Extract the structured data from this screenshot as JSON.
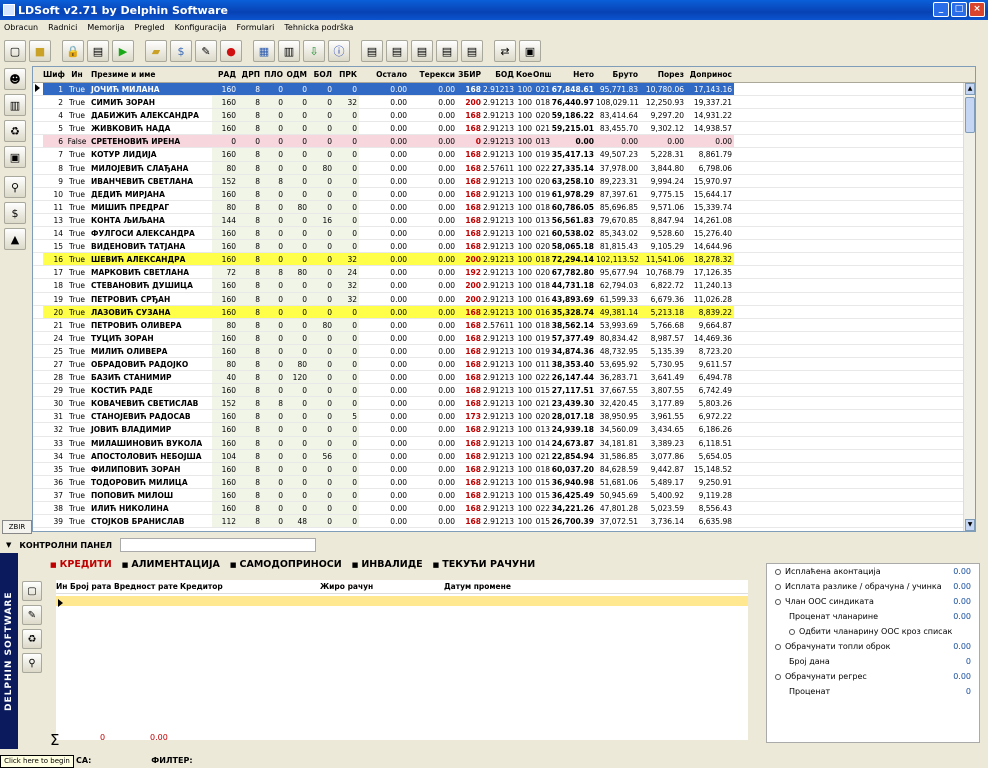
{
  "window": {
    "title": "LDSoft v2.71 by Delphin Software",
    "minimize": "_",
    "maximize": "□",
    "close": "×"
  },
  "menu": [
    "Obracun",
    "Radnici",
    "Memorija",
    "Pregled",
    "Konfiguracija",
    "Formulari",
    "Tehnicka podrška"
  ],
  "toolbar_icons": [
    "new-icon",
    "folder-icon",
    "lock-icon",
    "calculator-icon",
    "play-icon",
    "open-folder-icon",
    "money-bag-icon",
    "edit-icon",
    "record-icon",
    "document-icon",
    "printer-icon",
    "export-icon",
    "info-icon",
    "report1-icon",
    "report2-icon",
    "report3-icon",
    "report4-icon",
    "report5-icon",
    "network-icon",
    "monitor-icon"
  ],
  "left_icons": [
    "person-icon",
    "printer-icon",
    "recycle-icon",
    "box-icon",
    "pin-icon",
    "money-icon",
    "stamp-icon"
  ],
  "zbir": "ZBIR",
  "columns": [
    "Шиф.",
    "Ин",
    "Презиме и име",
    "РАД",
    "ДРП",
    "ПЛО",
    "ОДМ",
    "БОЛ",
    "ПРК",
    "Остало",
    "Терекси",
    "ЗБИР",
    "БОД",
    "Коеф",
    "Опш",
    "Нето",
    "Бруто",
    "Порез",
    "Доприноc"
  ],
  "rows": [
    [
      "1",
      "True",
      "ЈОЧИЋ МИЛАНА",
      "160",
      "8",
      "0",
      "0",
      "0",
      "0",
      "0.00",
      "0.00",
      "168",
      "2.91213",
      "100",
      "021",
      "67,848.61",
      "95,771.83",
      "10,780.06",
      "17,143.16"
    ],
    [
      "2",
      "True",
      "СИМИЋ ЗОРАН",
      "160",
      "8",
      "0",
      "0",
      "0",
      "32",
      "0.00",
      "0.00",
      "200",
      "2.91213",
      "100",
      "018",
      "76,440.97",
      "108,029.11",
      "12,250.93",
      "19,337.21"
    ],
    [
      "4",
      "True",
      "ДАБИЖИЋ АЛЕКСАНДРА",
      "160",
      "8",
      "0",
      "0",
      "0",
      "0",
      "0.00",
      "0.00",
      "168",
      "2.91213",
      "100",
      "020",
      "59,186.22",
      "83,414.64",
      "9,297.20",
      "14,931.22"
    ],
    [
      "5",
      "True",
      "ЖИВКОВИЋ НАДА",
      "160",
      "8",
      "0",
      "0",
      "0",
      "0",
      "0.00",
      "0.00",
      "168",
      "2.91213",
      "100",
      "021",
      "59,215.01",
      "83,455.70",
      "9,302.12",
      "14,938.57"
    ],
    [
      "6",
      "False",
      "СРЕТЕНОВИЋ ИРЕНА",
      "0",
      "0",
      "0",
      "0",
      "0",
      "0",
      "0.00",
      "0.00",
      "0",
      "2.91213",
      "100",
      "013",
      "0.00",
      "0.00",
      "0.00",
      "0.00"
    ],
    [
      "7",
      "True",
      "КОТУР ЛИДИЈА",
      "160",
      "8",
      "0",
      "0",
      "0",
      "0",
      "0.00",
      "0.00",
      "168",
      "2.91213",
      "100",
      "019",
      "35,417.13",
      "49,507.23",
      "5,228.31",
      "8,861.79"
    ],
    [
      "8",
      "True",
      "МИЛОЈЕВИЋ СЛАЂАНА",
      "80",
      "8",
      "0",
      "0",
      "80",
      "0",
      "0.00",
      "0.00",
      "168",
      "2.57611",
      "100",
      "022",
      "27,335.14",
      "37,978.00",
      "3,844.80",
      "6,798.06"
    ],
    [
      "9",
      "True",
      "ИВАНЧЕВИЋ СВЕТЛАНА",
      "152",
      "8",
      "8",
      "0",
      "0",
      "0",
      "0.00",
      "0.00",
      "168",
      "2.91213",
      "100",
      "020",
      "63,258.10",
      "89,223.31",
      "9,994.24",
      "15,970.97"
    ],
    [
      "10",
      "True",
      "ДЕДИЋ МИРЈАНА",
      "160",
      "8",
      "0",
      "0",
      "0",
      "0",
      "0.00",
      "0.00",
      "168",
      "2.91213",
      "100",
      "019",
      "61,978.29",
      "87,397.61",
      "9,775.15",
      "15,644.17"
    ],
    [
      "11",
      "True",
      "МИШИЋ ПРЕДРАГ",
      "80",
      "8",
      "0",
      "80",
      "0",
      "0",
      "0.00",
      "0.00",
      "168",
      "2.91213",
      "100",
      "018",
      "60,786.05",
      "85,696.85",
      "9,571.06",
      "15,339.74"
    ],
    [
      "13",
      "True",
      "КОНТА ЉИЉАНА",
      "144",
      "8",
      "0",
      "0",
      "16",
      "0",
      "0.00",
      "0.00",
      "168",
      "2.91213",
      "100",
      "013",
      "56,561.83",
      "79,670.85",
      "8,847.94",
      "14,261.08"
    ],
    [
      "14",
      "True",
      "ФУЛГОСИ АЛЕКСАНДРА",
      "160",
      "8",
      "0",
      "0",
      "0",
      "0",
      "0.00",
      "0.00",
      "168",
      "2.91213",
      "100",
      "021",
      "60,538.02",
      "85,343.02",
      "9,528.60",
      "15,276.40"
    ],
    [
      "15",
      "True",
      "ВИДЕНОВИЋ ТАТЈАНА",
      "160",
      "8",
      "0",
      "0",
      "0",
      "0",
      "0.00",
      "0.00",
      "168",
      "2.91213",
      "100",
      "020",
      "58,065.18",
      "81,815.43",
      "9,105.29",
      "14,644.96"
    ],
    [
      "16",
      "True",
      "ШЕВИЋ АЛЕКСАНДРА",
      "160",
      "8",
      "0",
      "0",
      "0",
      "32",
      "0.00",
      "0.00",
      "200",
      "2.91213",
      "100",
      "018",
      "72,294.14",
      "102,113.52",
      "11,541.06",
      "18,278.32"
    ],
    [
      "17",
      "True",
      "МАРКОВИЋ СВЕТЛАНА",
      "72",
      "8",
      "8",
      "80",
      "0",
      "24",
      "0.00",
      "0.00",
      "192",
      "2.91213",
      "100",
      "020",
      "67,782.80",
      "95,677.94",
      "10,768.79",
      "17,126.35"
    ],
    [
      "18",
      "True",
      "СТЕВАНОВИЋ ДУШИЦА",
      "160",
      "8",
      "0",
      "0",
      "0",
      "32",
      "0.00",
      "0.00",
      "200",
      "2.91213",
      "100",
      "018",
      "44,731.18",
      "62,794.03",
      "6,822.72",
      "11,240.13"
    ],
    [
      "19",
      "True",
      "ПЕТРОВИЋ СРЂАН",
      "160",
      "8",
      "0",
      "0",
      "0",
      "32",
      "0.00",
      "0.00",
      "200",
      "2.91213",
      "100",
      "016",
      "43,893.69",
      "61,599.33",
      "6,679.36",
      "11,026.28"
    ],
    [
      "20",
      "True",
      "ЛАЗОВИЋ СУЗАНА",
      "160",
      "8",
      "0",
      "0",
      "0",
      "0",
      "0.00",
      "0.00",
      "168",
      "2.91213",
      "100",
      "016",
      "35,328.74",
      "49,381.14",
      "5,213.18",
      "8,839.22"
    ],
    [
      "21",
      "True",
      "ПЕТРОВИЋ ОЛИВЕРА",
      "80",
      "8",
      "0",
      "0",
      "80",
      "0",
      "0.00",
      "0.00",
      "168",
      "2.57611",
      "100",
      "018",
      "38,562.14",
      "53,993.69",
      "5,766.68",
      "9,664.87"
    ],
    [
      "24",
      "True",
      "ТУЦИЋ ЗОРАН",
      "160",
      "8",
      "0",
      "0",
      "0",
      "0",
      "0.00",
      "0.00",
      "168",
      "2.91213",
      "100",
      "019",
      "57,377.49",
      "80,834.42",
      "8,987.57",
      "14,469.36"
    ],
    [
      "25",
      "True",
      "МИЛИЋ ОЛИВЕРА",
      "160",
      "8",
      "0",
      "0",
      "0",
      "0",
      "0.00",
      "0.00",
      "168",
      "2.91213",
      "100",
      "019",
      "34,874.36",
      "48,732.95",
      "5,135.39",
      "8,723.20"
    ],
    [
      "27",
      "True",
      "ОБРАДОВИЋ РАДОЈКО",
      "80",
      "8",
      "0",
      "80",
      "0",
      "0",
      "0.00",
      "0.00",
      "168",
      "2.91213",
      "100",
      "011",
      "38,353.40",
      "53,695.92",
      "5,730.95",
      "9,611.57"
    ],
    [
      "28",
      "True",
      "БАЗИЋ СТАНИМИР",
      "40",
      "8",
      "0",
      "120",
      "0",
      "0",
      "0.00",
      "0.00",
      "168",
      "2.91213",
      "100",
      "022",
      "26,147.44",
      "36,283.71",
      "3,641.49",
      "6,494.78"
    ],
    [
      "29",
      "True",
      "КОСТИЋ РАДЕ",
      "160",
      "8",
      "0",
      "0",
      "0",
      "0",
      "0.00",
      "0.00",
      "168",
      "2.91213",
      "100",
      "015",
      "27,117.51",
      "37,667.55",
      "3,807.55",
      "6,742.49"
    ],
    [
      "30",
      "True",
      "КОВАЧЕВИЋ СВЕТИСЛАВ",
      "152",
      "8",
      "8",
      "0",
      "0",
      "0",
      "0.00",
      "0.00",
      "168",
      "2.91213",
      "100",
      "021",
      "23,439.30",
      "32,420.45",
      "3,177.89",
      "5,803.26"
    ],
    [
      "31",
      "True",
      "СТАНОЈЕВИЋ РАДОСАВ",
      "160",
      "8",
      "0",
      "0",
      "0",
      "5",
      "0.00",
      "0.00",
      "173",
      "2.91213",
      "100",
      "020",
      "28,017.18",
      "38,950.95",
      "3,961.55",
      "6,972.22"
    ],
    [
      "32",
      "True",
      "ЈОВИЋ ВЛАДИМИР",
      "160",
      "8",
      "0",
      "0",
      "0",
      "0",
      "0.00",
      "0.00",
      "168",
      "2.91213",
      "100",
      "013",
      "24,939.18",
      "34,560.09",
      "3,434.65",
      "6,186.26"
    ],
    [
      "33",
      "True",
      "МИЛАШИНОВИЋ ВУКОЛА",
      "160",
      "8",
      "0",
      "0",
      "0",
      "0",
      "0.00",
      "0.00",
      "168",
      "2.91213",
      "100",
      "014",
      "24,673.87",
      "34,181.81",
      "3,389.23",
      "6,118.51"
    ],
    [
      "34",
      "True",
      "АПОСТОЛОВИЋ НЕБОЈША",
      "104",
      "8",
      "0",
      "0",
      "56",
      "0",
      "0.00",
      "0.00",
      "168",
      "2.91213",
      "100",
      "021",
      "22,854.94",
      "31,586.85",
      "3,077.86",
      "5,654.05"
    ],
    [
      "35",
      "True",
      "ФИЛИПОВИЋ ЗОРАН",
      "160",
      "8",
      "0",
      "0",
      "0",
      "0",
      "0.00",
      "0.00",
      "168",
      "2.91213",
      "100",
      "018",
      "60,037.20",
      "84,628.59",
      "9,442.87",
      "15,148.52"
    ],
    [
      "36",
      "True",
      "ТОДОРОВИЋ МИЛИЦА",
      "160",
      "8",
      "0",
      "0",
      "0",
      "0",
      "0.00",
      "0.00",
      "168",
      "2.91213",
      "100",
      "015",
      "36,940.98",
      "51,681.06",
      "5,489.17",
      "9,250.91"
    ],
    [
      "37",
      "True",
      "ПОПОВИЋ МИЛОШ",
      "160",
      "8",
      "0",
      "0",
      "0",
      "0",
      "0.00",
      "0.00",
      "168",
      "2.91213",
      "100",
      "015",
      "36,425.49",
      "50,945.69",
      "5,400.92",
      "9,119.28"
    ],
    [
      "38",
      "True",
      "ИЛИЋ НИКОЛИНА",
      "160",
      "8",
      "0",
      "0",
      "0",
      "0",
      "0.00",
      "0.00",
      "168",
      "2.91213",
      "100",
      "022",
      "34,221.26",
      "47,801.28",
      "5,023.59",
      "8,556.43"
    ],
    [
      "39",
      "True",
      "СТОЈКОВ БРАНИСЛАВ",
      "112",
      "8",
      "0",
      "48",
      "0",
      "0",
      "0.00",
      "0.00",
      "168",
      "2.91213",
      "100",
      "015",
      "26,700.39",
      "37,072.51",
      "3,736.14",
      "6,635.98"
    ]
  ],
  "row_states": {
    "selected": [
      0
    ],
    "pink": [
      4
    ],
    "yellow": [
      13,
      17
    ]
  },
  "control_panel": {
    "label": "КОНТРОЛНИ ПАНЕЛ"
  },
  "logo": "DELPHIN SOFTWARE",
  "tabs": [
    "КРЕДИТИ",
    "АЛИМЕНТАЦИЈА",
    "САМОДОПРИНОСИ",
    "ИНВАЛИДЕ",
    "ТЕКУЋИ РАЧУНИ"
  ],
  "sub_columns": [
    "Ин",
    "Број рата",
    "Вредност рате",
    "Кредитор",
    "Жиро рачун",
    "Датум промене"
  ],
  "sigma": {
    "symbol": "Σ",
    "count": "0",
    "total": "0.00"
  },
  "right_panel": [
    {
      "label": "Исплаћена аконтација",
      "value": "0.00",
      "radio": true
    },
    {
      "label": "Исплата разлике / обрачуна / учинка",
      "value": "0.00",
      "radio": true
    },
    {
      "label": "Члан ООС синдиката",
      "value": "0.00",
      "radio": true
    },
    {
      "label": "Проценат чланарине",
      "value": "0.00",
      "radio": false,
      "indent": true
    },
    {
      "label": "Одбити чланарину ООС кроз списак",
      "value": "",
      "radio": true,
      "indent": true
    },
    {
      "label": "Обрачунати топли оброк",
      "value": "0.00",
      "radio": true
    },
    {
      "label": "Број дана",
      "value": "0",
      "radio": false,
      "indent": true
    },
    {
      "label": "Обрачунати регрес",
      "value": "0.00",
      "radio": true
    },
    {
      "label": "Проценат",
      "value": "0",
      "radio": false,
      "indent": true
    }
  ],
  "status": {
    "left": "СА:",
    "filter": "ФИЛТЕР:",
    "tooltip": "Click here to begin"
  }
}
